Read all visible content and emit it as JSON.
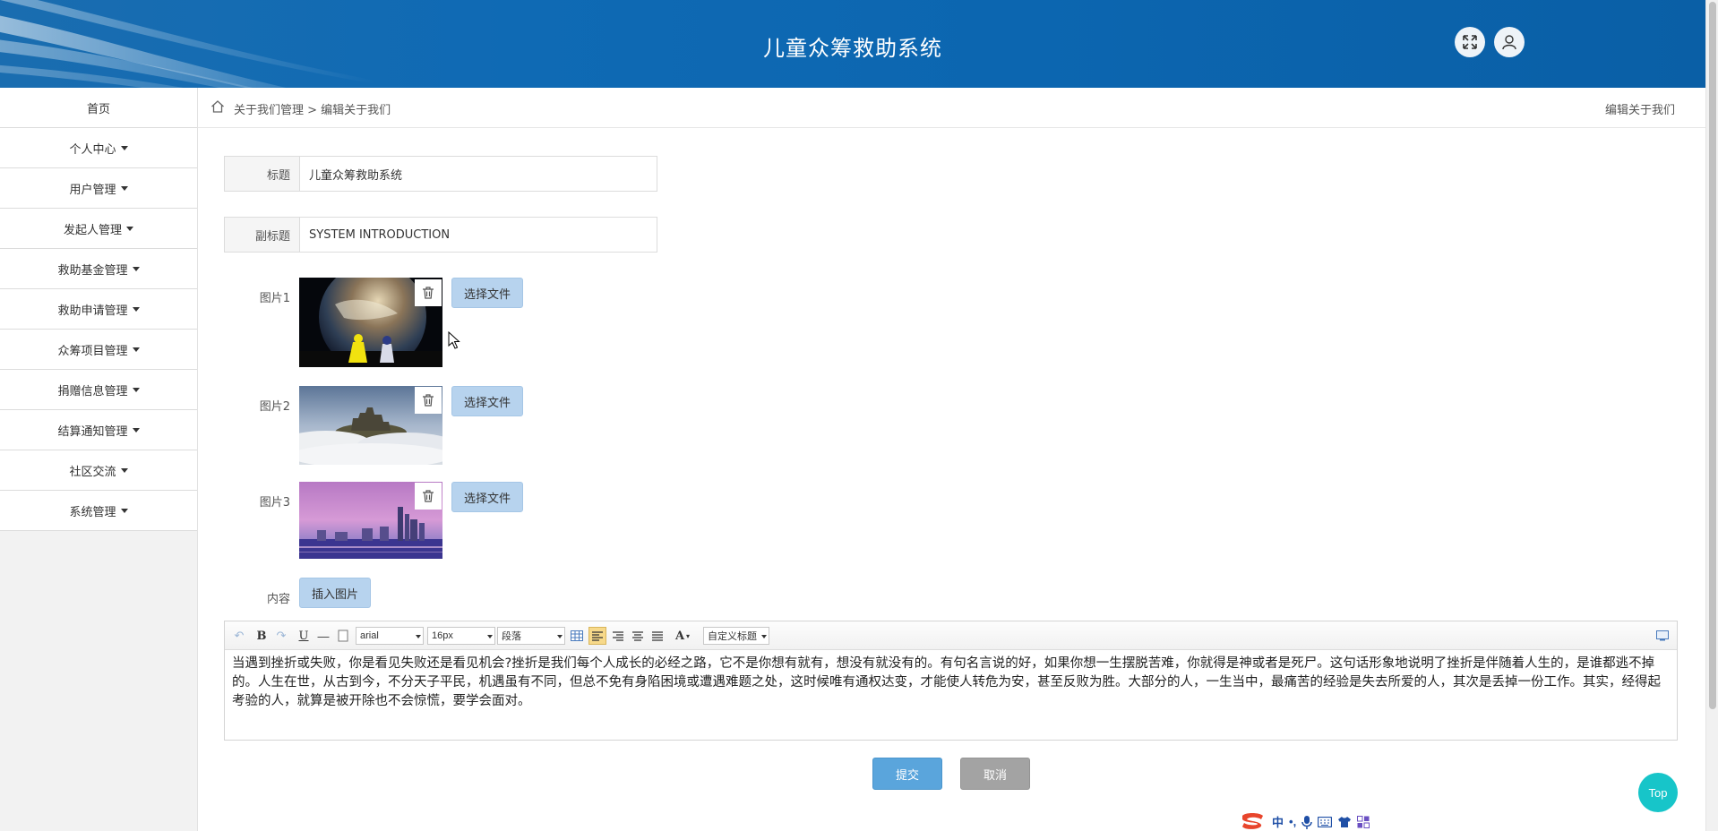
{
  "header": {
    "title": "儿童众筹救助系统"
  },
  "sidebar": {
    "items": [
      {
        "label": "首页",
        "has_caret": false
      },
      {
        "label": "个人中心",
        "has_caret": true
      },
      {
        "label": "用户管理",
        "has_caret": true
      },
      {
        "label": "发起人管理",
        "has_caret": true
      },
      {
        "label": "救助基金管理",
        "has_caret": true
      },
      {
        "label": "救助申请管理",
        "has_caret": true
      },
      {
        "label": "众筹项目管理",
        "has_caret": true
      },
      {
        "label": "捐赠信息管理",
        "has_caret": true
      },
      {
        "label": "结算通知管理",
        "has_caret": true
      },
      {
        "label": "社区交流",
        "has_caret": true
      },
      {
        "label": "系统管理",
        "has_caret": true
      }
    ]
  },
  "breadcrumb": {
    "path": "关于我们管理 > 编辑关于我们",
    "right": "编辑关于我们"
  },
  "form": {
    "title_label": "标题",
    "title_value": "儿童众筹救助系统",
    "subtitle_label": "副标题",
    "subtitle_value": "SYSTEM INTRODUCTION",
    "images": [
      {
        "label": "图片1",
        "button": "选择文件"
      },
      {
        "label": "图片2",
        "button": "选择文件"
      },
      {
        "label": "图片3",
        "button": "选择文件"
      }
    ],
    "content_label": "内容",
    "insert_image": "插入图片"
  },
  "editor": {
    "font_family": "arial",
    "font_size": "16px",
    "paragraph": "段落",
    "custom_title": "自定义标题",
    "content": "当遇到挫折或失败，你是看见失败还是看见机会?挫折是我们每个人成长的必经之路，它不是你想有就有，想没有就没有的。有句名言说的好，如果你想一生摆脱苦难，你就得是神或者是死尸。这句话形象地说明了挫折是伴随着人生的，是谁都逃不掉的。人生在世，从古到今，不分天子平民，机遇虽有不同，但总不免有身陷困境或遭遇难题之处，这时候唯有通权达变，才能使人转危为安，甚至反败为胜。大部分的人，一生当中，最痛苦的经验是失去所爱的人，其次是丢掉一份工作。其实，经得起考验的人，就算是被开除也不会惊慌，要学会面对。"
  },
  "actions": {
    "submit": "提交",
    "cancel": "取消"
  },
  "top_button": "Top",
  "ime": {
    "mode": "中",
    "punct": "•,"
  },
  "colors": {
    "header_bg": "#0c66b0",
    "file_button": "#b7d3ee",
    "submit": "#5aa5dc",
    "cancel": "#a3a3a3",
    "top_button": "#17c5c9"
  }
}
